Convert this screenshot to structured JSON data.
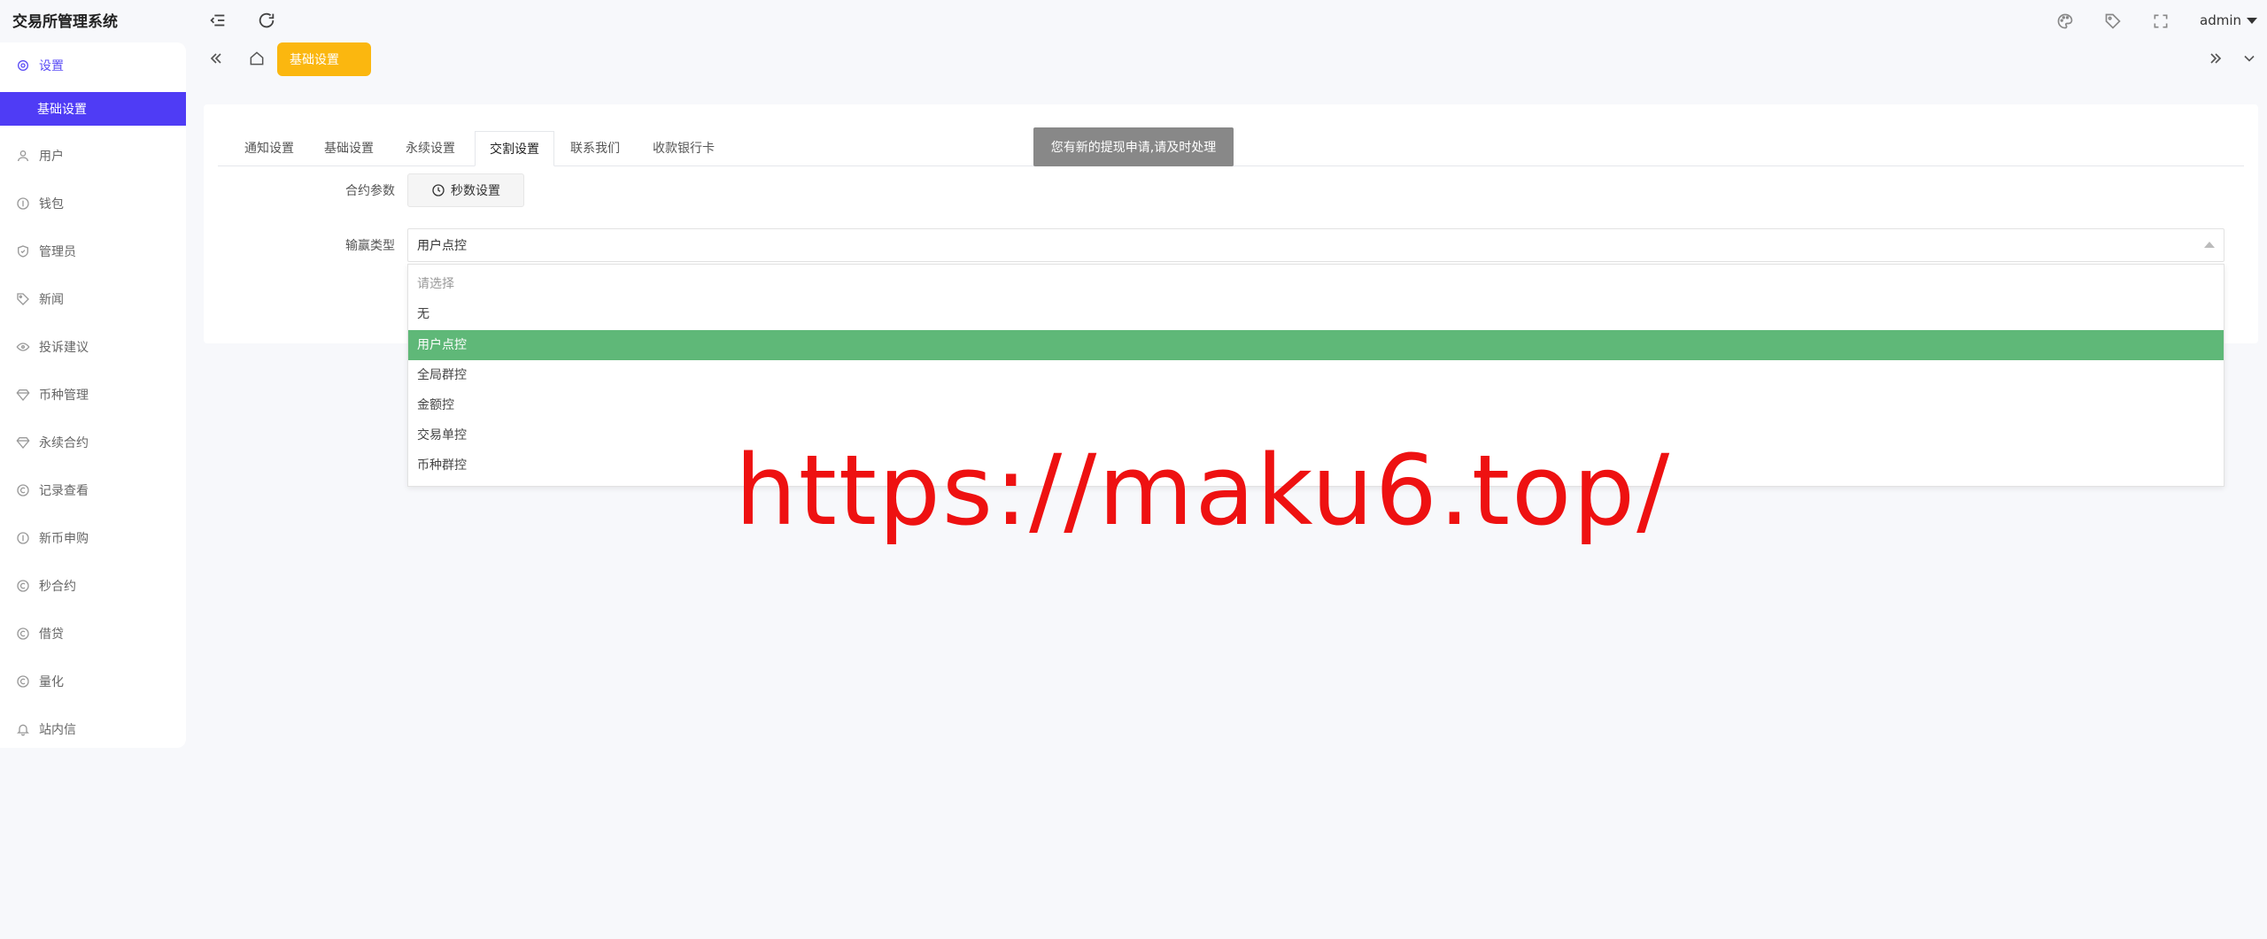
{
  "header": {
    "app_title": "交易所管理系统",
    "user": "admin",
    "icons": [
      "menu-collapse-icon",
      "refresh-icon",
      "palette-icon",
      "tag-icon",
      "fullscreen-icon"
    ]
  },
  "sidebar": {
    "items": [
      {
        "label": "设置",
        "icon": "gear-icon"
      },
      {
        "label": "用户",
        "icon": "user-icon"
      },
      {
        "label": "钱包",
        "icon": "coin-icon"
      },
      {
        "label": "管理员",
        "icon": "shield-icon"
      },
      {
        "label": "新闻",
        "icon": "tag-icon"
      },
      {
        "label": "投诉建议",
        "icon": "eye-icon"
      },
      {
        "label": "币种管理",
        "icon": "diamond-icon"
      },
      {
        "label": "永续合约",
        "icon": "diamond-icon"
      },
      {
        "label": "记录查看",
        "icon": "record-icon"
      },
      {
        "label": "新币申购",
        "icon": "coin-icon"
      },
      {
        "label": "秒合约",
        "icon": "record-icon"
      },
      {
        "label": "借贷",
        "icon": "record-icon"
      },
      {
        "label": "量化",
        "icon": "record-icon"
      },
      {
        "label": "站内信",
        "icon": "bell-icon"
      }
    ],
    "sub_active": "基础设置"
  },
  "tabbar": {
    "active_tab": "基础设置"
  },
  "panel": {
    "tabs": [
      "通知设置",
      "基础设置",
      "永续设置",
      "交割设置",
      "联系我们",
      "收款银行卡"
    ],
    "active_tab_index": 3,
    "contract_label": "合约参数",
    "seconds_button": "秒数设置",
    "win_type_label": "输赢类型",
    "select_value": "用户点控",
    "options": [
      {
        "label": "请选择",
        "placeholder": true
      },
      {
        "label": "无"
      },
      {
        "label": "用户点控",
        "selected": true
      },
      {
        "label": "全局群控"
      },
      {
        "label": "金额控"
      },
      {
        "label": "交易单控"
      },
      {
        "label": "币种群控"
      }
    ]
  },
  "toast": "您有新的提现申请,请及时处理",
  "watermark": "https://maku6.top/",
  "colors": {
    "primary": "#4f3cf5",
    "tab_yellow": "#fbb70f",
    "selected_green": "#5fb878",
    "toast_gray": "#888888",
    "watermark_red": "#ee1111"
  }
}
